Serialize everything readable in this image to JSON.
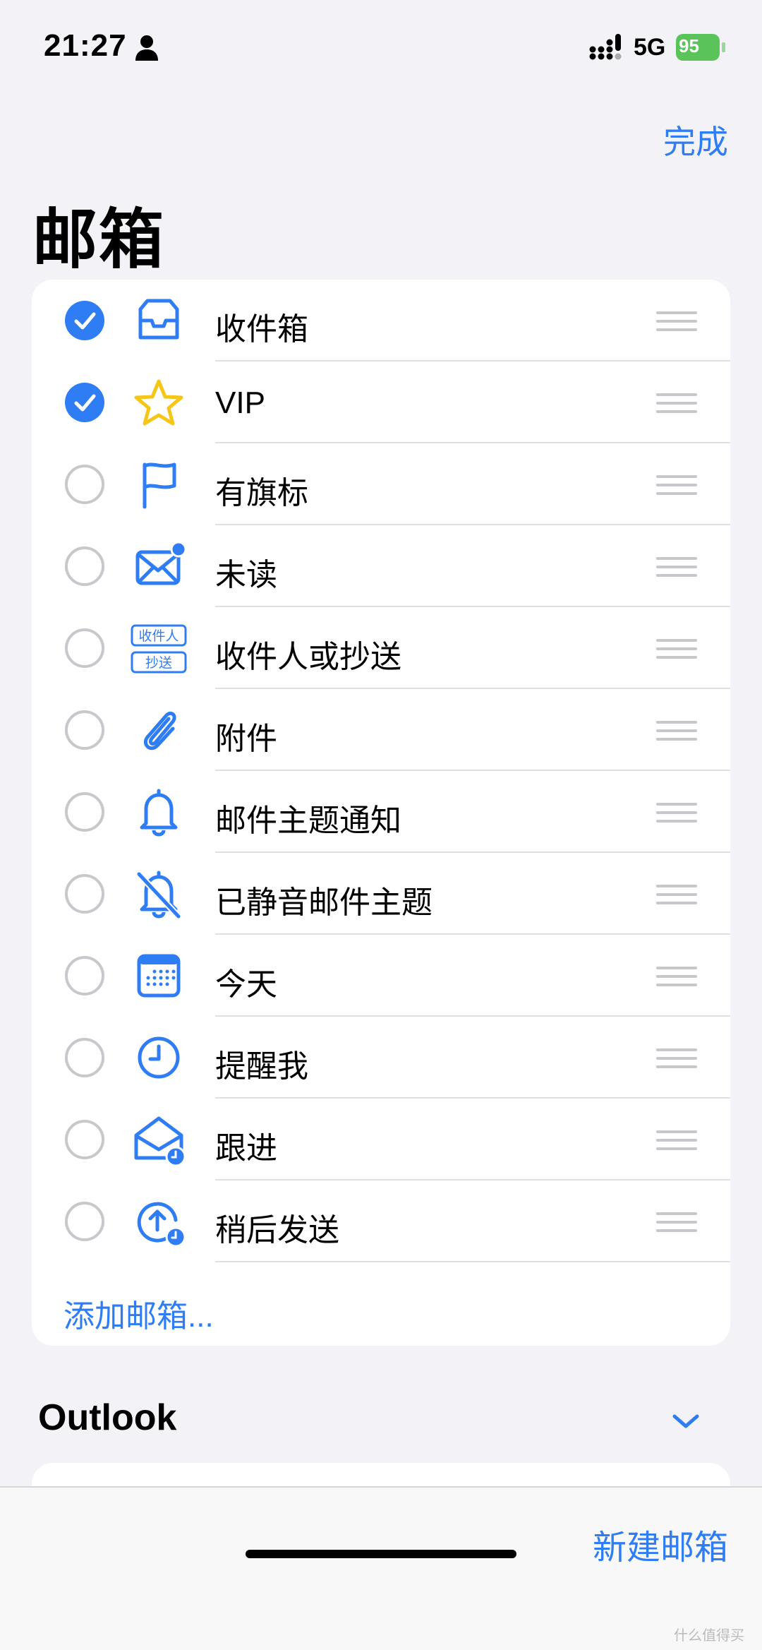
{
  "status_bar": {
    "time": "21:27",
    "network": "5G",
    "battery": "95"
  },
  "header": {
    "done_label": "完成",
    "title": "邮箱"
  },
  "mailboxes": [
    {
      "label": "收件箱",
      "checked": true,
      "icon": "inbox-icon"
    },
    {
      "label": "VIP",
      "checked": true,
      "icon": "star-icon"
    },
    {
      "label": "有旗标",
      "checked": false,
      "icon": "flag-icon"
    },
    {
      "label": "未读",
      "checked": false,
      "icon": "unread-envelope-icon"
    },
    {
      "label": "收件人或抄送",
      "checked": false,
      "icon": "to-cc-icon",
      "icon_text": [
        "收件人",
        "抄送"
      ]
    },
    {
      "label": "附件",
      "checked": false,
      "icon": "paperclip-icon"
    },
    {
      "label": "邮件主题通知",
      "checked": false,
      "icon": "bell-icon"
    },
    {
      "label": "已静音邮件主题",
      "checked": false,
      "icon": "bell-slash-icon"
    },
    {
      "label": "今天",
      "checked": false,
      "icon": "calendar-icon"
    },
    {
      "label": "提醒我",
      "checked": false,
      "icon": "clock-icon"
    },
    {
      "label": "跟进",
      "checked": false,
      "icon": "envelope-clock-icon"
    },
    {
      "label": "稍后发送",
      "checked": false,
      "icon": "send-later-icon"
    }
  ],
  "add_mailbox_label": "添加邮箱...",
  "section": {
    "title": "Outlook"
  },
  "bottom_bar": {
    "new_mailbox_label": "新建邮箱"
  },
  "watermark": "什么值得买",
  "colors": {
    "accent": "#2f7df5",
    "star": "#f5c518",
    "battery": "#5ac45a",
    "background": "#f2f2f7"
  }
}
